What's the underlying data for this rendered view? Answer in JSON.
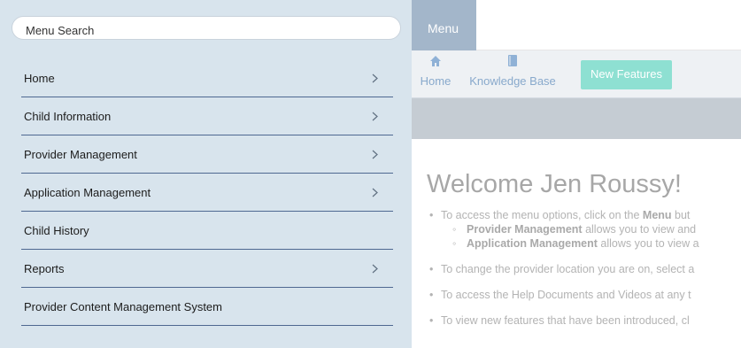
{
  "topbar": {
    "menu_tab_label": "Menu"
  },
  "nav": {
    "home_label": "Home",
    "knowledge_base_label": "Knowledge Base",
    "new_features_label": "New Features"
  },
  "welcome": {
    "heading": "Welcome Jen Roussy!",
    "line1_pre": "To access the menu options, click on the ",
    "line1_bold": "Menu",
    "line1_post": " but",
    "line2_bold": "Provider Management",
    "line2_post": " allows you to view and",
    "line3_bold": "Application Management",
    "line3_post": " allows you to view a",
    "line4": "To change the provider location you are on, select a",
    "line5": "To access the Help Documents and Videos at any t",
    "line6": "To view new features that have been introduced, cl"
  },
  "menu": {
    "search_placeholder": "Menu Search",
    "items": [
      {
        "label": "Home",
        "has_chevron": true
      },
      {
        "label": "Child Information",
        "has_chevron": true
      },
      {
        "label": "Provider Management",
        "has_chevron": true
      },
      {
        "label": "Application Management",
        "has_chevron": true
      },
      {
        "label": "Child History",
        "has_chevron": false
      },
      {
        "label": "Reports",
        "has_chevron": true
      },
      {
        "label": "Provider Content Management System",
        "has_chevron": false
      }
    ]
  },
  "icons": {
    "chevron": "chevron-right-icon",
    "home": "home-icon",
    "knowledge_base": "book-icon"
  },
  "colors": {
    "menu_panel_bg": "#d8e4ed",
    "menu_divider": "#4e6891",
    "menu_tab_bg": "#a3b6ca",
    "new_features_bg": "#8ee0d2",
    "nav_text": "#88a9cc"
  }
}
